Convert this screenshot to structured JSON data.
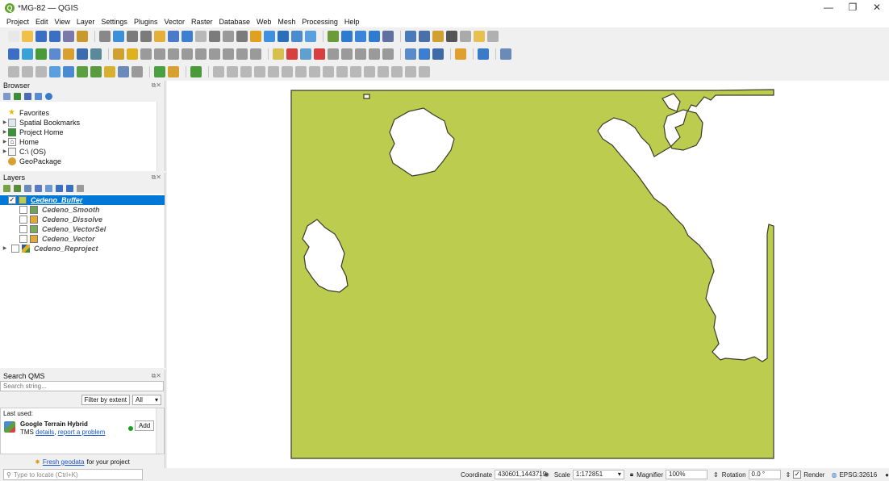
{
  "window": {
    "title": "*MG-82 — QGIS",
    "minimize": "—",
    "maximize": "❐",
    "close": "✕"
  },
  "menu": [
    "Project",
    "Edit",
    "View",
    "Layer",
    "Settings",
    "Plugins",
    "Vector",
    "Raster",
    "Database",
    "Web",
    "Mesh",
    "Processing",
    "Help"
  ],
  "toolbar_colors": {
    "row1": [
      "#e8e8e8",
      "#f0c04a",
      "#3a6fc4",
      "#3a6fc4",
      "#7a7aaa",
      "#c89a2a",
      "|",
      "#888",
      "#3d8fd8",
      "#7b7b7b",
      "#7b7b7b",
      "#e4b03a",
      "#4a7ac8",
      "#3c7fd0",
      "#b8b8b8",
      "#7b7b7b",
      "#9a9a9a",
      "#7b7b7b",
      "#e0a020",
      "#3f90e0",
      "#2a6fb8",
      "#4a8bd0",
      "#5aa0e0",
      "|",
      "#6a9a3a",
      "#2e7bd0",
      "#3b84d8",
      "#2e7bd0",
      "#6070a0",
      "|",
      "#4a7ab8",
      "#4b6fa8",
      "#d0a030",
      "#555",
      "#aaaaaa",
      "#e8c050",
      "#b0b0b0"
    ],
    "row2": [
      "#3a6fc4",
      "#3aa0d8",
      "#4a9a3a",
      "#5a8ad0",
      "#d8a030",
      "#3c6cb0",
      "#5a8a9a",
      "|",
      "#d0a030",
      "#e0b020",
      "#9a9a9a",
      "#9a9a9a",
      "#9a9a9a",
      "#9a9a9a",
      "#9a9a9a",
      "#9a9a9a",
      "#9a9a9a",
      "#9a9a9a",
      "#9a9a9a",
      "|",
      "#d8c050",
      "#d84040",
      "#60a0d0",
      "#d84040",
      "#9a9a9a",
      "#9a9a9a",
      "#9a9a9a",
      "#9a9a9a",
      "#9a9a9a",
      "|",
      "#5a8ac8",
      "#3c7fd0",
      "#3e6aa8",
      "|",
      "#e0a030",
      "|",
      "#3a7ac8",
      "|",
      "#6a8ab8"
    ],
    "row3": [
      "#b8b8b8",
      "#b8b8b8",
      "#b8b8b8",
      "#5aa0e0",
      "#4a8ad0",
      "#5aa040",
      "#5a9a40",
      "#d8b030",
      "#6a8ab8",
      "#9a9a9a",
      "|",
      "#4aa040",
      "#d8a030",
      "|",
      "#4a9a3a",
      "|",
      "#b8b8b8",
      "#b8b8b8",
      "#b8b8b8",
      "#b8b8b8",
      "#b8b8b8",
      "#b8b8b8",
      "#b8b8b8",
      "#b8b8b8",
      "#b8b8b8",
      "#b8b8b8",
      "#b8b8b8",
      "#b8b8b8",
      "#b8b8b8",
      "#b8b8b8",
      "#b8b8b8",
      "#b8b8b8"
    ]
  },
  "browser": {
    "title": "Browser",
    "tool_icons": [
      "add-layer-icon",
      "refresh-icon",
      "filter-icon",
      "collapse-icon",
      "info-icon"
    ],
    "items": [
      {
        "label": "Favorites",
        "icon": "star-icon",
        "expander": ""
      },
      {
        "label": "Spatial Bookmarks",
        "icon": "bookmark-icon",
        "expander": "▶"
      },
      {
        "label": "Project Home",
        "icon": "folder-icon",
        "expander": "▶"
      },
      {
        "label": "Home",
        "icon": "home-icon",
        "expander": "▶"
      },
      {
        "label": "C:\\ (OS)",
        "icon": "drive-icon",
        "expander": "▶"
      },
      {
        "label": "GeoPackage",
        "icon": "geopackage-icon",
        "expander": ""
      }
    ]
  },
  "layers": {
    "title": "Layers",
    "items": [
      {
        "name": "Cedeno_Buffer",
        "checked": true,
        "color": "#bccc4e",
        "selected": true
      },
      {
        "name": "Cedeno_Smooth",
        "checked": false,
        "color": "#6ea25a",
        "selected": false
      },
      {
        "name": "Cedeno_Dissolve",
        "checked": false,
        "color": "#e4a83a",
        "selected": false
      },
      {
        "name": "Cedeno_VectorSel",
        "checked": false,
        "color": "#7aaa5e",
        "selected": false
      },
      {
        "name": "Cedeno_Vector",
        "checked": false,
        "color": "#e4a83a",
        "selected": false
      },
      {
        "name": "Cedeno_Reproject",
        "checked": false,
        "color": "raster",
        "selected": false
      }
    ]
  },
  "search_qms": {
    "title": "Search QMS",
    "placeholder": "Search string...",
    "filter_button": "Filter by extent",
    "filter_value": "All",
    "last_used_label": "Last used:",
    "service_name": "Google Terrain Hybrid",
    "service_type": "TMS",
    "details_link": "details",
    "report_link": "report a problem",
    "add_button": "Add",
    "fresh_link": "Fresh geodata",
    "fresh_suffix": "for your project"
  },
  "status": {
    "locate_placeholder": "Type to locate (Ctrl+K)",
    "coordinate_label": "Coordinate",
    "coordinate_value": "430601,1443719",
    "scale_label": "Scale",
    "scale_value": "1:172851",
    "magnifier_label": "Magnifier",
    "magnifier_value": "100%",
    "rotation_label": "Rotation",
    "rotation_value": "0.0 °",
    "render_label": "Render",
    "crs": "EPSG:32616"
  },
  "map_fill": "#bccc4e"
}
